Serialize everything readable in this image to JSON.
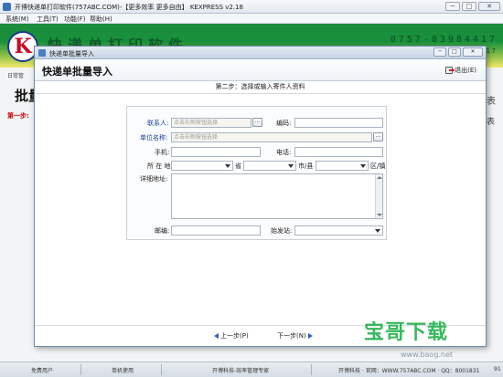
{
  "app": {
    "title": "开博快递单打印软件(757ABC.COM)-【更多效率 更多自由】  KEXPRESS v2.18",
    "window_buttons": [
      "─",
      "□",
      "✕"
    ]
  },
  "menu": [
    "系统(M)",
    "工具(T)",
    "功能(F)",
    "帮助(H)"
  ],
  "banner": {
    "logo_letter": "K",
    "brand_text": "快递单打印软件",
    "phone": "0757-83984417",
    "phone2": "7-83984417"
  },
  "background": {
    "tab_label": "日常管",
    "heading": "批量",
    "step_label": "第一步:",
    "right_1": "表",
    "right_2": "表"
  },
  "dialog": {
    "window_title": "快递单批量导入",
    "heading": "快递单批量导入",
    "exit_label": "退出(E)",
    "step_title": "第二步：选择或输入寄件人资料",
    "fields": {
      "contact_label": "联系人:",
      "contact_placeholder": "点击右侧按钮选择",
      "code_label": "编码:",
      "company_label": "单位名称:",
      "company_placeholder": "点击右侧按钮选择",
      "mobile_label": "手机:",
      "phone_label": "电话:",
      "location_label": "所 在 地:",
      "province_suffix": "省",
      "city_suffix": "市/县",
      "district_suffix": "区/镇",
      "address_label": "详细地址:",
      "postcode_label": "邮编:",
      "station_label": "始发站:"
    },
    "prev_label": "上一步(P)",
    "next_label": "下一步(N)"
  },
  "status_bar": {
    "user": "免费用户",
    "mode": "单机使用",
    "company": "开博科技-效率管理专家",
    "contact": "开博科技 · 官网：WWW.757ABC.COM · QQ：8001831",
    "tail": "91"
  },
  "watermark": {
    "main": "宝哥下载",
    "sub": "www.baog.net"
  }
}
